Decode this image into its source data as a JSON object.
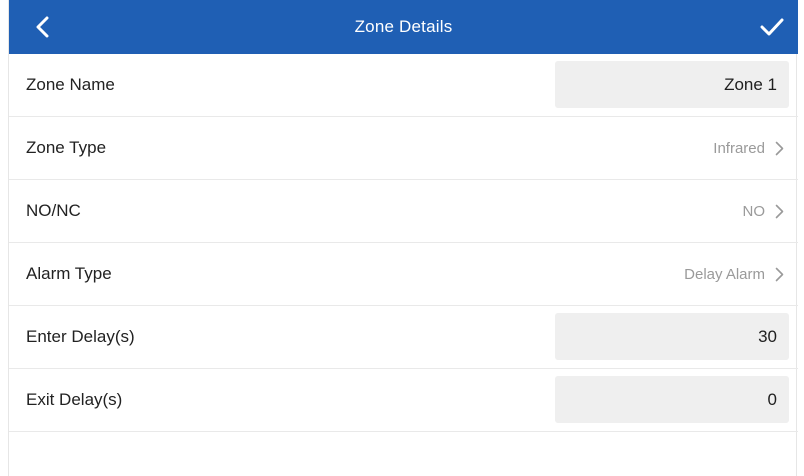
{
  "header": {
    "title": "Zone Details",
    "back_icon": "chevron-left-icon",
    "confirm_icon": "check-icon",
    "color": "#1f5fb4"
  },
  "fields": [
    {
      "label": "Zone Name",
      "type": "input",
      "value": "Zone 1"
    },
    {
      "label": "Zone Type",
      "type": "select",
      "value": "Infrared"
    },
    {
      "label": "NO/NC",
      "type": "select",
      "value": "NO"
    },
    {
      "label": "Alarm Type",
      "type": "select",
      "value": "Delay Alarm"
    },
    {
      "label": "Enter Delay(s)",
      "type": "input",
      "value": "30"
    },
    {
      "label": "Exit Delay(s)",
      "type": "input",
      "value": "0"
    }
  ]
}
